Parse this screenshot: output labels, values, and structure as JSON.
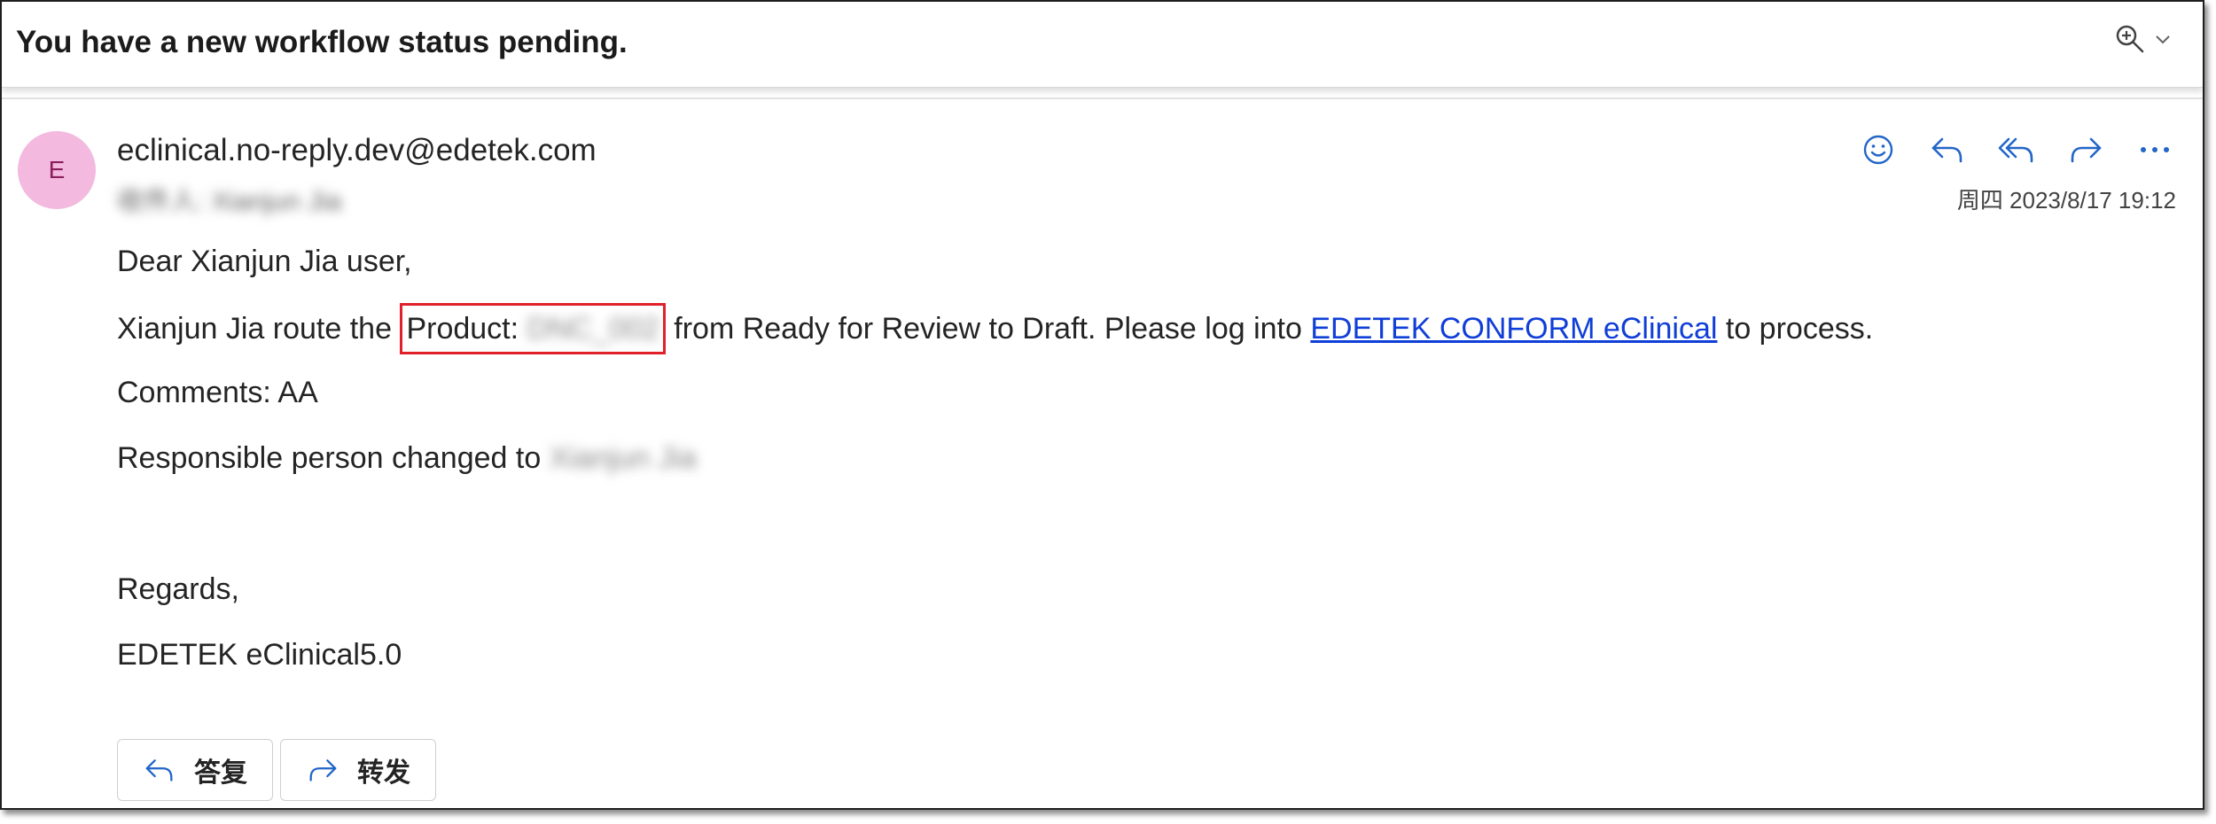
{
  "subject": "You have a new workflow status pending.",
  "sender": {
    "initial": "E",
    "email": "eclinical.no-reply.dev@edetek.com",
    "recipient": "收件人: Xianjun Jia",
    "date": "周四 2023/8/17 19:12"
  },
  "toolbar_icons": [
    "emoji-icon",
    "reply-icon",
    "reply-all-icon",
    "forward-icon",
    "more-icon"
  ],
  "body": {
    "greeting": "Dear Xianjun Jia user,",
    "route_prefix": "Xianjun Jia route the ",
    "product_label": "Product:",
    "product_value": "DNC_002",
    "route_suffix": " from Ready for Review to Draft. Please log into ",
    "link_text": "EDETEK CONFORM eClinical",
    "route_end": " to process.",
    "comments": "Comments: AA",
    "responsible_prefix": "Responsible person changed to ",
    "responsible_name": "Xianjun Jia",
    "regards": "Regards,",
    "signature": "EDETEK eClinical5.0"
  },
  "buttons": {
    "reply": "答复",
    "forward": "转发"
  },
  "colors": {
    "avatar_bg": "#f3b9df",
    "accent_icon": "#2266c8",
    "link": "#0f3ed8",
    "highlight_box": "#e0202a"
  }
}
